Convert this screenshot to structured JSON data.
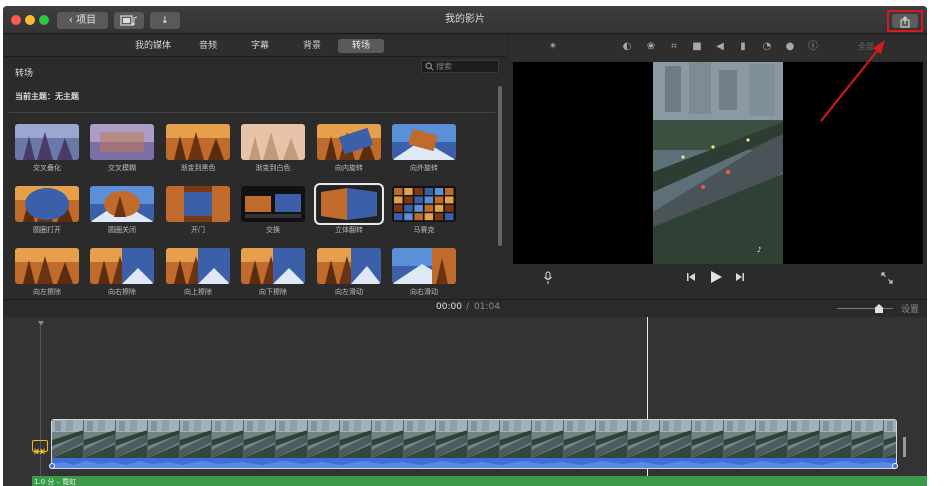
{
  "window": {
    "title": "我的影片",
    "back_label": "项目"
  },
  "browser": {
    "tabs": [
      {
        "label": "我的媒体",
        "active": false
      },
      {
        "label": "音频",
        "active": false
      },
      {
        "label": "字幕",
        "active": false
      },
      {
        "label": "背景",
        "active": false
      },
      {
        "label": "转场",
        "active": true
      }
    ],
    "section_title": "转场",
    "search_placeholder": "搜索",
    "theme_label": "当前主题：无主题",
    "transitions": [
      {
        "label": "交叉叠化",
        "style": "trees-blue"
      },
      {
        "label": "交叉模糊",
        "style": "blur"
      },
      {
        "label": "渐变到黑色",
        "style": "trees"
      },
      {
        "label": "渐变到白色",
        "style": "trees-white"
      },
      {
        "label": "向内旋转",
        "style": "spin-in"
      },
      {
        "label": "向外旋转",
        "style": "spin-out"
      },
      {
        "label": "圆圈打开",
        "style": "circle-open"
      },
      {
        "label": "圆圈关闭",
        "style": "circle-close"
      },
      {
        "label": "开门",
        "style": "doors"
      },
      {
        "label": "交换",
        "style": "swap"
      },
      {
        "label": "立体翻转",
        "style": "cube",
        "selected": true
      },
      {
        "label": "马赛克",
        "style": "mosaic"
      },
      {
        "label": "向左擦除",
        "style": "trees"
      },
      {
        "label": "向右擦除",
        "style": "trees-half"
      },
      {
        "label": "向上擦除",
        "style": "trees-half"
      },
      {
        "label": "向下擦除",
        "style": "trees-half"
      },
      {
        "label": "向左滑动",
        "style": "slide"
      },
      {
        "label": "向右滑动",
        "style": "slide-blue"
      }
    ]
  },
  "viewer": {
    "toolbar_right_label": "全部"
  },
  "timeline": {
    "current_time": "00:00",
    "separator": "/",
    "total_time": "01:04",
    "settings_label": "设置",
    "zoom_level": 0.75,
    "music_label": "1.0 分 – 霓虹"
  },
  "colors": {
    "highlight_red": "#d8191e",
    "clip_audio_blue": "#3d6fd8",
    "music_green": "#3a9a4a",
    "clip_marker_yellow": "#e9b82a"
  }
}
